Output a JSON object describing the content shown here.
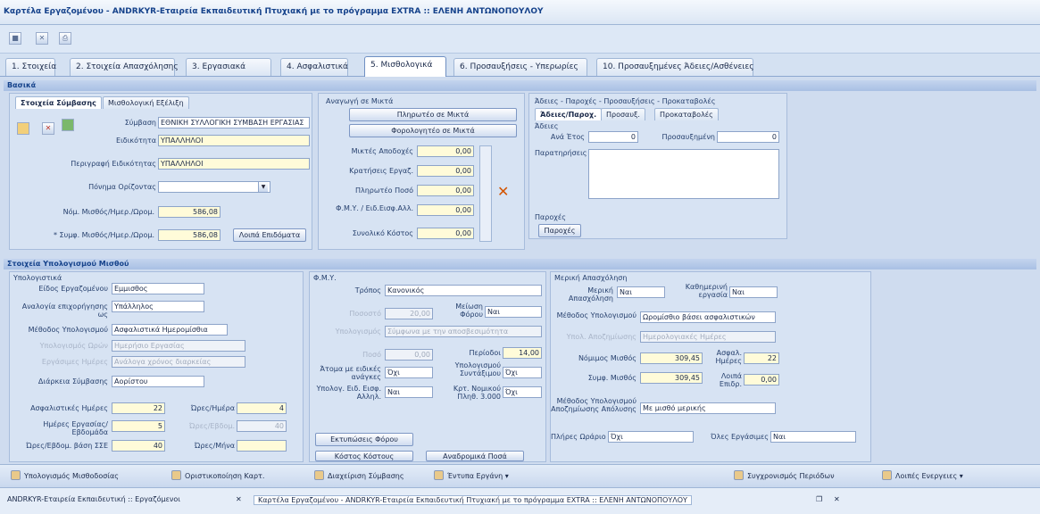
{
  "window": {
    "title": "Καρτέλα Εργαζομένου - ANDRKYR-Εταιρεία Εκπαιδευτική Πτυχιακή με το πρόγραμμα EXTRA :: ΕΛΕΝΗ ΑΝΤΩΝΟΠΟΥΛΟΥ"
  },
  "tabs": [
    {
      "label": "1. Στοιχεία"
    },
    {
      "label": "2. Στοιχεία Απασχόλησης"
    },
    {
      "label": "3. Εργασιακά"
    },
    {
      "label": "4. Ασφαλιστικά"
    },
    {
      "label": "5. Μισθολογικά"
    },
    {
      "label": "6. Προσαυξήσεις - Υπερωρίες"
    },
    {
      "label": "10. Προσαυξημένες Άδειες/Ασθένειες"
    }
  ],
  "basic": {
    "strip_label": "Βασικά",
    "subtabs": [
      "Στοιχεία Σύμβασης",
      "Μισθολογική Εξέλιξη"
    ],
    "fields": [
      {
        "label": "Σύμβαση",
        "value": "ΕΘΝΙΚΗ ΣΥΛΛΟΓΙΚΗ ΣΥΜΒΑΣΗ ΕΡΓΑΣΙΑΣ"
      },
      {
        "label": "Ειδικότητα",
        "value": "ΥΠΑΛΛΗΛΟΙ"
      },
      {
        "label": "Περιγραφή Ειδικότητας",
        "value": "ΥΠΑΛΛΗΛΟΙ"
      },
      {
        "label": "Πόνημα Ορίζοντας",
        "value": ""
      }
    ],
    "min_label": "Νόμ. Μισθός/Ημερ./Ωρομ.",
    "min_value": "586,08",
    "agreed_label": "* Συμφ. Μισθός/Ημερ./Ωρομ.",
    "agreed_value": "586,08",
    "allowances_button": "Λοιπά Επιδόματα"
  },
  "net": {
    "title": "Αναγωγή σε Μικτά",
    "btn1": "Πληρωτέο σε Μικτά",
    "btn2": "Φορολογητέο σε Μικτά",
    "rows": [
      {
        "label": "Μικτές Αποδοχές",
        "value": "0,00"
      },
      {
        "label": "Κρατήσεις Εργαζ.",
        "value": "0,00"
      },
      {
        "label": "Πληρωτέο Ποσό",
        "value": "0,00"
      },
      {
        "label": "Φ.Μ.Υ. / Ειδ.Εισφ.Αλλ.",
        "value": "0,00"
      },
      {
        "label": "Συνολικό Κόστος",
        "value": "0,00"
      }
    ]
  },
  "leaves": {
    "title": "Άδειες - Παροχές - Προσαυξήσεις - Προκαταβολές",
    "subtabs": [
      "Άδειες/Παροχ.",
      "Προσαυξ.",
      "Προκαταβολές"
    ],
    "section": "Άδειες",
    "annual_label": "Ανά Έτος",
    "annual_value": "0",
    "extra_label": "Προσαυξημένη",
    "extra_value": "0",
    "notes_label": "Παρατηρήσεις",
    "benefits_label": "Παροχές",
    "benefits_button": "Παροχές"
  },
  "calc": {
    "strip_label": "Στοιχεία Υπολογισμού Μισθού",
    "group": "Υπολογιστικά",
    "rows": [
      {
        "label": "Είδος Εργαζομένου",
        "value": "Εμμισθος",
        "style": "normal"
      },
      {
        "label": "Αναλογία επιχορήγησης ως",
        "value": "Υπάλληλος",
        "style": "normal"
      },
      {
        "label": "Μέθοδος Υπολογισμού",
        "value": "Ασφαλιστικά Ημερομίσθια",
        "style": "normal"
      },
      {
        "label": "Υπολογισμός Ωρών",
        "value": "Ημερήσιο Εργασίας",
        "style": "dis"
      },
      {
        "label": "Εργάσιμες Ημέρες",
        "value": "Ανάλογα χρόνος διαρκείας",
        "style": "dis"
      },
      {
        "label": "Διάρκεια Σύμβασης",
        "value": "Αορίστου",
        "style": "normal"
      }
    ],
    "insurance_days_label": "Ασφαλιστικές Ημέρες",
    "insurance_days": "22",
    "hours_day_label": "Ώρες/Ημέρα",
    "hours_day": "4",
    "work_days_label": "Ημέρες Εργασίας/Εβδομάδα",
    "work_days": "5",
    "weekly_hours_label": "Ώρες/Εβδομ.",
    "weekly_hours": "40",
    "hours_week_label": "Ώρες/Εβδομ. βάση ΣΣΕ",
    "hours_week": "40",
    "hours_month_label": "Ώρες/Μήνα",
    "hours_month": ""
  },
  "tax": {
    "title": "Φ.Μ.Υ.",
    "method_label": "Τρόπος",
    "method_value": "Κανονικός",
    "pct_label": "Ποσοστό",
    "pct_value": "20,00",
    "reduction_label": "Μείωση Φόρου",
    "reduction_value": "Ναι",
    "account_label": "Υπολογισμός",
    "account_value": "Σύμφωνα με την αποσβεσιμότητα",
    "amount_label": "Ποσό",
    "amount_value": "0,00",
    "periods_label": "Περίοδοι",
    "periods_value": "14,00",
    "special_label": "Άτομα με ειδικές ανάγκες",
    "special_value": "Όχι",
    "comp_label": "Υπολογισμού Συντάξιμου",
    "comp_value": "Όχι",
    "ded_label": "Υπολογ. Ειδ. Εισφ. Αλληλ.",
    "ded_value": "Ναι",
    "nom_label": "Κρτ. Νομικού Πληθ. 3.000",
    "nom_value": "Όχι",
    "tax_button": "Εκτυπώσεις Φόρου",
    "btn_cost": "Κόστος Κόστους",
    "btn_calc": "Αναδρομικά Ποσά"
  },
  "partial": {
    "title": "Μερική Απασχόληση",
    "partial_label": "Μερική Απασχόληση",
    "partial_value": "Ναι",
    "daily_label": "Καθημερινή εργασία",
    "daily_value": "Ναι",
    "method_label": "Μέθοδος Υπολογισμού",
    "method_value": "Ωρομίσθιο βάσει ασφαλιστικών",
    "hours_calc_label": "Υπολ. Αποζημίωσης",
    "hours_calc_value": "Ημερολογιακές Ημέρες",
    "legal_label": "Νόμιμος Μισθός",
    "legal_value": "309,45",
    "insdays_label": "Ασφαλ. Ημέρες",
    "insdays_value": "22",
    "agreed_label": "Συμφ. Μισθός",
    "agreed_value": "309,45",
    "other_label": "Λοιπά Επιδρ.",
    "other_value": "0,00",
    "comp_label": "Μέθοδος Υπολογισμού Αποζημίωσης Απόλυσης",
    "comp_value": "Με μισθό μερικής",
    "night_label": "Πλήρες Ωράριο",
    "night_value": "Όχι",
    "all_label": "Όλες Εργάσιμες",
    "all_value": "Ναι"
  },
  "bottom": [
    {
      "label": "Υπολογισμός Μισθοδοσίας"
    },
    {
      "label": "Οριστικοποίηση Καρτ."
    },
    {
      "label": "Διαχείριση Σύμβασης"
    },
    {
      "label": "Έντυπα Εργάνη"
    },
    {
      "label": "Συγχρονισμός Περιόδων"
    },
    {
      "label": "Λοιπές Ενεργειες"
    }
  ],
  "docs": [
    {
      "label": "ANDRKYR-Εταιρεία Εκπαιδευτική :: Εργαζόμενοι"
    },
    {
      "label": "Καρτέλα Εργαζομένου - ANDRKYR-Εταιρεία Εκπαιδευτική Πτυχιακή με το πρόγραμμα EXTRA :: ΕΛΕΝΗ ΑΝΤΩΝΟΠΟΥΛΟΥ"
    }
  ]
}
